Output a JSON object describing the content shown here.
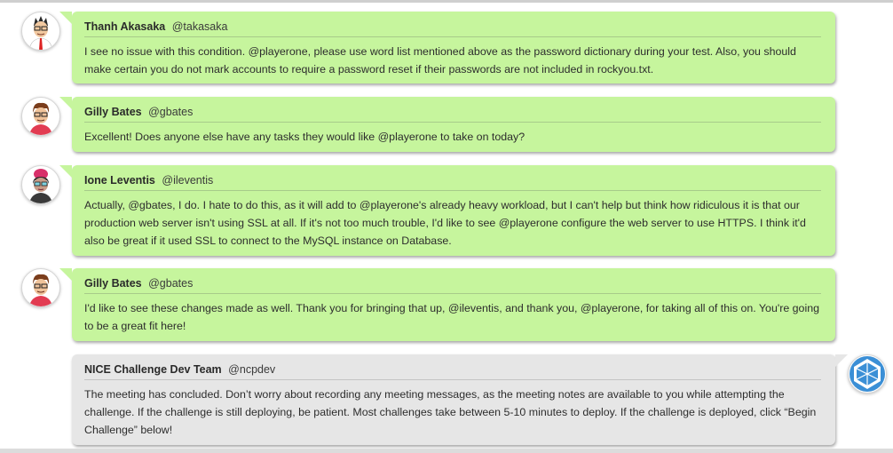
{
  "messages": [
    {
      "name": "Thanh Akasaka",
      "handle": "@takasaka",
      "text": "I see no issue with this condition. @playerone, please use word list mentioned above as the password dictionary during your test. Also, you should make certain you do not mark accounts to require a password reset if their passwords are not included in rockyou.txt.",
      "avatar": "thanh-avatar-icon",
      "style": "green"
    },
    {
      "name": "Gilly Bates",
      "handle": "@gbates",
      "text": "Excellent! Does anyone else have any tasks they would like @playerone to take on today?",
      "avatar": "gilly-avatar-icon",
      "style": "green"
    },
    {
      "name": "Ione Leventis",
      "handle": "@ileventis",
      "text": "Actually, @gbates, I do. I hate to do this, as it will add to @playerone's already heavy workload, but I can't help but think how ridiculous it is that our production web server isn't using SSL at all. If it's not too much trouble, I'd like to see @playerone configure the web server to use HTTPS. I think it'd also be great if it used SSL to connect to the MySQL instance on Database.",
      "avatar": "ione-avatar-icon",
      "style": "green"
    },
    {
      "name": "Gilly Bates",
      "handle": "@gbates",
      "text": "I'd like to see these changes made as well. Thank you for bringing that up, @ileventis, and thank you, @playerone, for taking all of this on. You're going to be a great fit here!",
      "avatar": "gilly-avatar-icon",
      "style": "green"
    },
    {
      "name": "NICE Challenge Dev Team",
      "handle": "@ncpdev",
      "text": "The meeting has concluded. Don’t worry about recording any meeting messages, as the meeting notes are available to you while attempting the challenge. If the challenge is still deploying, be patient. Most challenges take between 5-10 minutes to deploy. If the challenge is deployed, click “Begin Challenge” below!",
      "avatar": "nice-logo-icon",
      "style": "gray"
    }
  ],
  "colors": {
    "bubble_green": "#c6f59d",
    "bubble_gray": "#e6e6e6",
    "nice_blue": "#3b8fd6"
  }
}
